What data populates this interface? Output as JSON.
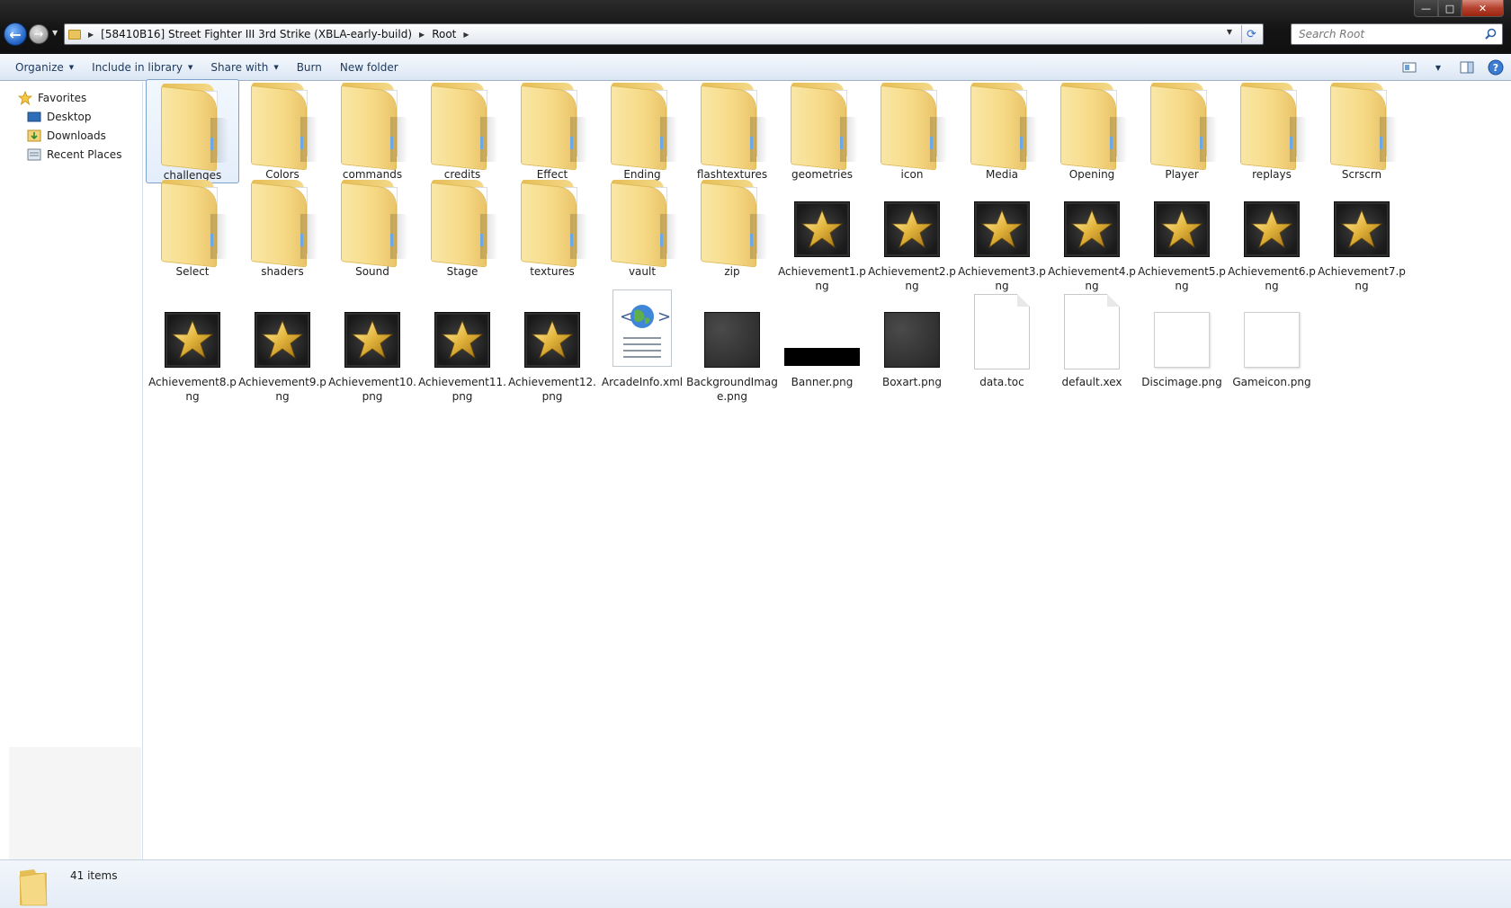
{
  "window": {
    "minimize_glyph": "—",
    "maximize_glyph": "□",
    "close_glyph": "✕"
  },
  "nav": {
    "back_glyph": "←",
    "forward_glyph": "→"
  },
  "address": {
    "crumbs": [
      "[58410B16] Street Fighter III 3rd Strike (XBLA-early-build)",
      "Root"
    ]
  },
  "search": {
    "placeholder": "Search Root"
  },
  "toolbar": {
    "organize": "Organize",
    "include_in_library": "Include in library",
    "share_with": "Share with",
    "burn": "Burn",
    "new_folder": "New folder"
  },
  "sidebar": {
    "items": [
      {
        "label": "Favorites",
        "icon": "star-icon"
      },
      {
        "label": "Desktop",
        "icon": "desktop-icon"
      },
      {
        "label": "Downloads",
        "icon": "downloads-icon"
      },
      {
        "label": "Recent Places",
        "icon": "recent-places-icon"
      }
    ]
  },
  "files": [
    {
      "name": "challenges",
      "type": "folder"
    },
    {
      "name": "Colors",
      "type": "folder"
    },
    {
      "name": "commands",
      "type": "folder"
    },
    {
      "name": "credits",
      "type": "folder"
    },
    {
      "name": "Effect",
      "type": "folder"
    },
    {
      "name": "Ending",
      "type": "folder"
    },
    {
      "name": "flashtextures",
      "type": "folder"
    },
    {
      "name": "geometries",
      "type": "folder"
    },
    {
      "name": "icon",
      "type": "folder"
    },
    {
      "name": "Media",
      "type": "folder"
    },
    {
      "name": "Opening",
      "type": "folder"
    },
    {
      "name": "Player",
      "type": "folder"
    },
    {
      "name": "replays",
      "type": "folder"
    },
    {
      "name": "Scrscrn",
      "type": "folder"
    },
    {
      "name": "Select",
      "type": "folder"
    },
    {
      "name": "shaders",
      "type": "folder"
    },
    {
      "name": "Sound",
      "type": "folder"
    },
    {
      "name": "Stage",
      "type": "folder"
    },
    {
      "name": "textures",
      "type": "folder"
    },
    {
      "name": "vault",
      "type": "folder"
    },
    {
      "name": "zip",
      "type": "folder"
    },
    {
      "name": "Achievement1.png",
      "type": "achievement"
    },
    {
      "name": "Achievement2.png",
      "type": "achievement"
    },
    {
      "name": "Achievement3.png",
      "type": "achievement"
    },
    {
      "name": "Achievement4.png",
      "type": "achievement"
    },
    {
      "name": "Achievement5.png",
      "type": "achievement"
    },
    {
      "name": "Achievement6.png",
      "type": "achievement"
    },
    {
      "name": "Achievement7.png",
      "type": "achievement"
    },
    {
      "name": "Achievement8.png",
      "type": "achievement"
    },
    {
      "name": "Achievement9.png",
      "type": "achievement"
    },
    {
      "name": "Achievement10.png",
      "type": "achievement"
    },
    {
      "name": "Achievement11.png",
      "type": "achievement"
    },
    {
      "name": "Achievement12.png",
      "type": "achievement"
    },
    {
      "name": "ArcadeInfo.xml",
      "type": "xml"
    },
    {
      "name": "BackgroundImage.png",
      "type": "texture"
    },
    {
      "name": "Banner.png",
      "type": "banner"
    },
    {
      "name": "Boxart.png",
      "type": "texture"
    },
    {
      "name": "data.toc",
      "type": "document"
    },
    {
      "name": "default.xex",
      "type": "document"
    },
    {
      "name": "Discimage.png",
      "type": "white-image"
    },
    {
      "name": "Gameicon.png",
      "type": "white-image"
    }
  ],
  "selected_file": "challenges",
  "status": {
    "item_count": "41 items"
  }
}
